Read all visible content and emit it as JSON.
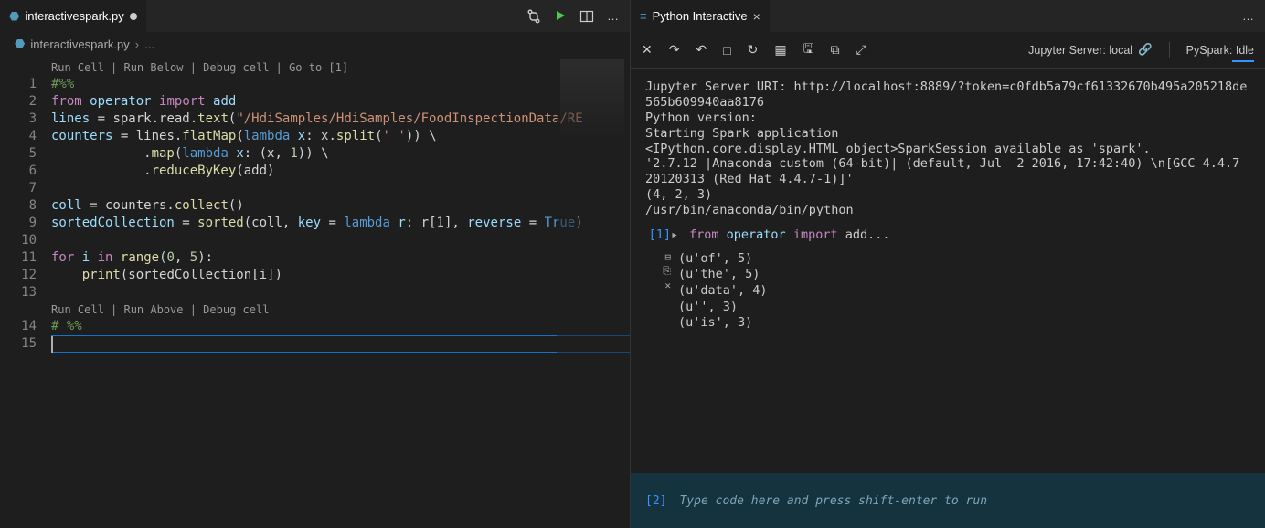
{
  "editor": {
    "tab": {
      "filename": "interactivespark.py",
      "modified": true
    },
    "actions": {
      "git_compare": "git-compare-icon",
      "run": "run-icon",
      "split": "split-icon",
      "more": "…"
    },
    "breadcrumb": {
      "file": "interactivespark.py",
      "trail": "..."
    },
    "codelens1": "Run Cell | Run Below | Debug cell | Go to [1]",
    "codelens2": "Run Cell | Run Above | Debug cell",
    "code_tokens": [
      [
        [
          "t-comment",
          "#%%"
        ]
      ],
      [
        [
          "t-kw",
          "from"
        ],
        [
          "",
          " "
        ],
        [
          "t-var",
          "operator"
        ],
        [
          "",
          " "
        ],
        [
          "t-kw",
          "import"
        ],
        [
          "",
          " "
        ],
        [
          "t-var",
          "add"
        ]
      ],
      [
        [
          "t-var",
          "lines"
        ],
        [
          "",
          " = spark.read."
        ],
        [
          "t-fn",
          "text"
        ],
        [
          "",
          "("
        ],
        [
          "t-str",
          "\"/HdiSamples/HdiSamples/FoodInspectionData/RE"
        ]
      ],
      [
        [
          "t-var",
          "counters"
        ],
        [
          "",
          " = lines."
        ],
        [
          "t-fn",
          "flatMap"
        ],
        [
          "",
          "("
        ],
        [
          "t-blue",
          "lambda"
        ],
        [
          "",
          " "
        ],
        [
          "t-var",
          "x"
        ],
        [
          "",
          ": x."
        ],
        [
          "t-fn",
          "split"
        ],
        [
          "",
          "("
        ],
        [
          "t-str",
          "' '"
        ],
        [
          "",
          ")) \\"
        ]
      ],
      [
        [
          "",
          "            ."
        ],
        [
          "t-fn",
          "map"
        ],
        [
          "",
          "("
        ],
        [
          "t-blue",
          "lambda"
        ],
        [
          "",
          " "
        ],
        [
          "t-var",
          "x"
        ],
        [
          "",
          ": (x, "
        ],
        [
          "t-num",
          "1"
        ],
        [
          "",
          ")) \\"
        ]
      ],
      [
        [
          "",
          "            ."
        ],
        [
          "t-fn",
          "reduceByKey"
        ],
        [
          "",
          "(add)"
        ]
      ],
      [
        [
          "",
          ""
        ]
      ],
      [
        [
          "t-var",
          "coll"
        ],
        [
          "",
          " = counters."
        ],
        [
          "t-fn",
          "collect"
        ],
        [
          "",
          "()"
        ]
      ],
      [
        [
          "t-var",
          "sortedCollection"
        ],
        [
          "",
          " = "
        ],
        [
          "t-builtin",
          "sorted"
        ],
        [
          "",
          "(coll, "
        ],
        [
          "t-var",
          "key"
        ],
        [
          "",
          " = "
        ],
        [
          "t-blue",
          "lambda"
        ],
        [
          "",
          " "
        ],
        [
          "t-var",
          "r"
        ],
        [
          "",
          ": r["
        ],
        [
          "t-num",
          "1"
        ],
        [
          "",
          "], "
        ],
        [
          "t-var",
          "reverse"
        ],
        [
          "",
          " = "
        ],
        [
          "t-lit",
          "True"
        ],
        [
          "",
          ")"
        ]
      ],
      [
        [
          "",
          ""
        ]
      ],
      [
        [
          "t-kw",
          "for"
        ],
        [
          "",
          " "
        ],
        [
          "t-var",
          "i"
        ],
        [
          "",
          " "
        ],
        [
          "t-kw",
          "in"
        ],
        [
          "",
          " "
        ],
        [
          "t-builtin",
          "range"
        ],
        [
          "",
          "("
        ],
        [
          "t-num",
          "0"
        ],
        [
          "",
          ", "
        ],
        [
          "t-num",
          "5"
        ],
        [
          "",
          "):"
        ]
      ],
      [
        [
          "",
          "    "
        ],
        [
          "t-builtin",
          "print"
        ],
        [
          "",
          "(sortedCollection[i])"
        ]
      ],
      [
        [
          "",
          ""
        ]
      ]
    ],
    "code_line14": "# %%",
    "code_line15": "",
    "line_count": 15
  },
  "interactive": {
    "tab": "Python Interactive",
    "jupyter_label": "Jupyter Server: local",
    "pyspark_label": "PySpark: Idle",
    "stdout": "Jupyter Server URI: http://localhost:8889/?token=c0fdb5a79cf61332670b495a205218de565b609940aa8176\nPython version:\nStarting Spark application\n<IPython.core.display.HTML object>SparkSession available as 'spark'.\n'2.7.12 |Anaconda custom (64-bit)| (default, Jul  2 2016, 17:42:40) \\n[GCC 4.4.7 20120313 (Red Hat 4.4.7-1)]'\n(4, 2, 3)\n/usr/bin/anaconda/bin/python",
    "cell1": {
      "prompt": "[1]",
      "code_tokens": [
        [
          "t-kw",
          "from"
        ],
        [
          "",
          " "
        ],
        [
          "t-var",
          "operator"
        ],
        [
          "",
          " "
        ],
        [
          "t-kw",
          "import"
        ],
        [
          "",
          " "
        ],
        [
          "",
          "add..."
        ]
      ],
      "out": "(u'of', 5)\n(u'the', 5)\n(u'data', 4)\n(u'', 3)\n(u'is', 3)"
    },
    "input": {
      "prompt": "[2]",
      "placeholder": "Type code here and press shift-enter to run"
    }
  }
}
